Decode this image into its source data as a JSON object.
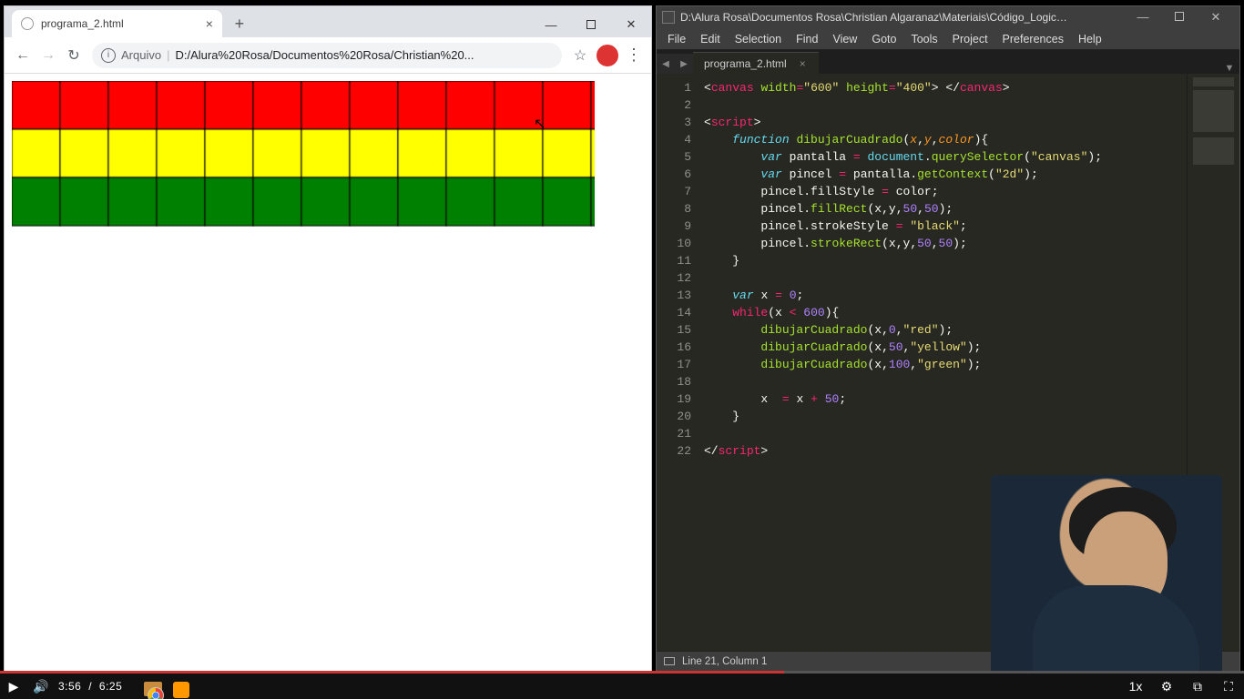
{
  "chrome": {
    "tab_title": "programa_2.html",
    "omnibox_label": "Arquivo",
    "omnibox_path": "D:/Alura%20Rosa/Documentos%20Rosa/Christian%20...",
    "nav": {
      "back": "←",
      "forward": "→",
      "reload": "↻",
      "star": "☆",
      "more": "⋮"
    },
    "winctrl": {
      "min": "—",
      "close": "✕"
    }
  },
  "sublime": {
    "title": "D:\\Alura Rosa\\Documentos Rosa\\Christian Algaranaz\\Materiais\\Código_Logica ...",
    "menu": [
      "File",
      "Edit",
      "Selection",
      "Find",
      "View",
      "Goto",
      "Tools",
      "Project",
      "Preferences",
      "Help"
    ],
    "tab": "programa_2.html",
    "status": "Line 21, Column 1",
    "line_count": 22,
    "winctrl": {
      "min": "—",
      "close": "✕"
    }
  },
  "code_data": {
    "canvas": {
      "width": "600",
      "height": "400"
    },
    "function_name": "dibujarCuadrado",
    "params": [
      "x",
      "y",
      "color"
    ],
    "body": [
      "var pantalla = document.querySelector(\"canvas\");",
      "var pincel = pantalla.getContext(\"2d\");",
      "pincel.fillStyle = color;",
      "pincel.fillRect(x,y,50,50);",
      "pincel.strokeStyle = \"black\";",
      "pincel.strokeRect(x,y,50,50);"
    ],
    "loop": {
      "init": "var x = 0;",
      "cond": "x < 600",
      "calls": [
        {
          "x": "x",
          "y": "0",
          "color": "red"
        },
        {
          "x": "x",
          "y": "50",
          "color": "yellow"
        },
        {
          "x": "x",
          "y": "100",
          "color": "green"
        }
      ],
      "step": "x  = x + 50;"
    }
  },
  "player": {
    "play": "▶",
    "volume": "🔊",
    "current": "3:56",
    "sep": "/",
    "total": "6:25",
    "right": {
      "speed": "1x",
      "gear": "⚙",
      "pip": "⧉",
      "full": "⛶"
    }
  }
}
